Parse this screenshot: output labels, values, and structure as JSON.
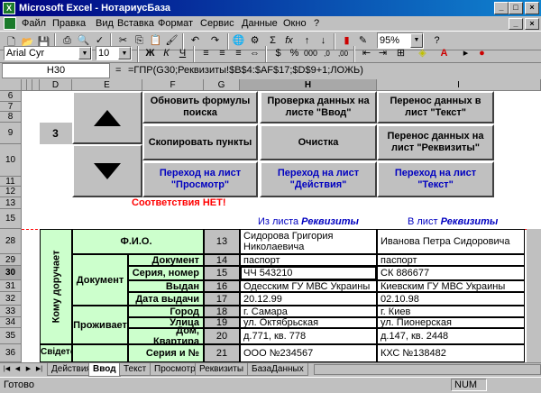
{
  "window": {
    "title": "Microsoft Excel - НотариусБаза",
    "app_icon": "X"
  },
  "menu": [
    "Файл",
    "Правка",
    "Вид",
    "Вставка",
    "Формат",
    "Сервис",
    "Данные",
    "Окно",
    "?"
  ],
  "toolbar": {
    "zoom": "95%",
    "font": "Arial Cyr",
    "size": "10",
    "bold": "Ж",
    "italic": "К",
    "underline": "Ч",
    "sum": "Σ",
    "fx": "fx",
    "percent": "%",
    "currency": "$"
  },
  "formula_bar": {
    "name_box": "H30",
    "equals": "=",
    "formula": "=ГПР(G30;Реквизиты!$B$4:$AF$17;$D$9+1;ЛОЖЬ)"
  },
  "columns": [
    "A",
    "B",
    "C",
    "D",
    "E",
    "F",
    "G",
    "H",
    "I"
  ],
  "rows": [
    "6",
    "7",
    "8",
    "9",
    "10",
    "11",
    "12",
    "13",
    "15",
    "28",
    "29",
    "30",
    "31",
    "32",
    "33",
    "34",
    "35",
    "36"
  ],
  "cells": {
    "d9": "3",
    "no_match": "Соответствия НЕТ!",
    "from_prefix": "Из листа",
    "from_sheet": "Реквизиты",
    "to_prefix": "В лист",
    "to_sheet": "Реквизиты"
  },
  "buttons": {
    "update": "Обновить формулы поиска",
    "check": "Проверка данных на листе \"Ввод\"",
    "move_text": "Перенос данных в лист \"Текст\"",
    "copy": "Скопировать пункты",
    "clear": "Очистка",
    "move_req": "Перенос данных на лист \"Реквизиты\"",
    "go_view": "Переход на лист \"Просмотр\"",
    "go_actions": "Переход на лист \"Действия\"",
    "go_text": "Переход на лист \"Текст\""
  },
  "form": {
    "side_label": "Кому доручает",
    "side_label2": "Свідетельс",
    "fio": "Ф.И.О.",
    "doc_group": "Документ",
    "live_group": "Проживает",
    "items": [
      {
        "label": "Документ",
        "num": "14",
        "from": "паспорт",
        "to": "паспорт"
      },
      {
        "label": "Серия, номер",
        "num": "15",
        "from": "ЧЧ 543210",
        "to": "СК 886677"
      },
      {
        "label": "Выдан",
        "num": "16",
        "from": "Одесским ГУ МВС Украины",
        "to": "Киевским ГУ МВС Украины"
      },
      {
        "label": "Дата выдачи",
        "num": "17",
        "from": "20.12.99",
        "to": "02.10.98"
      },
      {
        "label": "Город",
        "num": "18",
        "from": "г. Самара",
        "to": "г. Киев"
      },
      {
        "label": "Улица",
        "num": "19",
        "from": "ул. Октябрьская",
        "to": "ул. Пионерская"
      },
      {
        "label": "Дом, Квартира",
        "num": "20",
        "from": "д.771, кв. 778",
        "to": "д.147, кв. 2448"
      },
      {
        "label": "Серия и №",
        "num": "21",
        "from": "ООО №234567",
        "to": "КХС №138482"
      }
    ],
    "fio_num": "13",
    "fio_from": "Сидорова Григория Николаевича",
    "fio_to": "Иванова Петра Сидоровича"
  },
  "sheets": [
    "Действия",
    "Ввод",
    "Текст",
    "Просмотр",
    "Реквизиты",
    "БазаДанных"
  ],
  "status": {
    "ready": "Готово",
    "num": "NUM"
  },
  "colors": {
    "title": "#000080",
    "green": "#ccffcc",
    "red": "#ff0000",
    "blue": "#0000c0"
  }
}
